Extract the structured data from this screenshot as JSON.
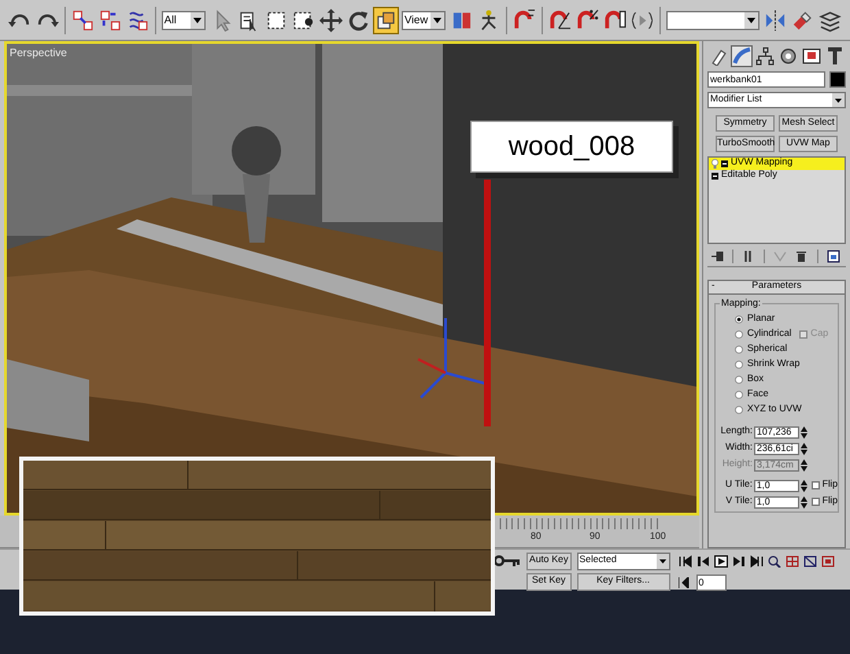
{
  "toolbar": {
    "items": [
      {
        "kind": "icon",
        "selected": false
      },
      {
        "kind": "icon",
        "selected": false
      },
      {
        "kind": "icon",
        "selected": false
      },
      {
        "kind": "icon",
        "selected": false
      },
      {
        "kind": "icon",
        "selected": false
      },
      {
        "kind": "dropdown",
        "value": "All"
      },
      {
        "kind": "icon",
        "selected": false
      },
      {
        "kind": "icon",
        "selected": false
      },
      {
        "kind": "icon",
        "selected": false
      },
      {
        "kind": "icon",
        "selected": false
      },
      {
        "kind": "icon",
        "selected": false
      },
      {
        "kind": "icon",
        "selected": false
      },
      {
        "kind": "icon",
        "selected": true
      },
      {
        "kind": "dropdown",
        "value": "View"
      },
      {
        "kind": "icon",
        "selected": false
      },
      {
        "kind": "icon",
        "selected": false
      },
      {
        "kind": "icon",
        "selected": false
      },
      {
        "kind": "icon",
        "selected": false
      },
      {
        "kind": "icon",
        "selected": false
      },
      {
        "kind": "icon",
        "selected": false
      },
      {
        "kind": "icon",
        "selected": false
      },
      {
        "kind": "dropdown",
        "value": ""
      },
      {
        "kind": "icon",
        "selected": false
      },
      {
        "kind": "icon",
        "selected": false
      },
      {
        "kind": "icon",
        "selected": false
      }
    ]
  },
  "viewport": {
    "label": "Perspective",
    "callout": "wood_008"
  },
  "command_panel": {
    "tabs": [
      {
        "selected": false
      },
      {
        "selected": true
      },
      {
        "selected": false
      },
      {
        "selected": false
      },
      {
        "selected": false
      },
      {
        "selected": false
      }
    ],
    "object_name": "werkbank01",
    "modifier_list": "Modifier List",
    "modifier_buttons": [
      "Symmetry",
      "Mesh Select",
      "TurboSmooth",
      "UVW Map"
    ],
    "stack": [
      {
        "label": "UVW Mapping",
        "selected": true
      },
      {
        "label": "Editable Poly",
        "selected": false
      }
    ],
    "parameters": {
      "collapse": "-",
      "title": "Parameters",
      "group": "Mapping:",
      "mapping": [
        {
          "label": "Planar",
          "selected": true
        },
        {
          "label": "Cylindrical",
          "selected": false,
          "option": {
            "label": "Cap",
            "checked": false
          }
        },
        {
          "label": "Spherical",
          "selected": false
        },
        {
          "label": "Shrink Wrap",
          "selected": false
        },
        {
          "label": "Box",
          "selected": false
        },
        {
          "label": "Face",
          "selected": false
        },
        {
          "label": "XYZ to UVW",
          "selected": false
        }
      ],
      "sizes": [
        {
          "label": "Length:",
          "value": "107,236",
          "disabled": false
        },
        {
          "label": "Width:",
          "value": "236,61ci",
          "disabled": false
        },
        {
          "label": "Height:",
          "value": "3,174cm",
          "disabled": true
        }
      ],
      "tiles": [
        {
          "label": "U Tile:",
          "value": "1,0",
          "flip": {
            "label": "Flip",
            "checked": false
          }
        },
        {
          "label": "V Tile:",
          "value": "1,0",
          "flip": {
            "label": "Flip",
            "checked": false
          }
        }
      ]
    }
  },
  "timeline": {
    "ticks": [
      "80",
      "90",
      "100"
    ]
  },
  "animation_controls": {
    "auto_key": "Auto Key",
    "set_key": "Set Key",
    "key_mode": "Selected",
    "key_filters": "Key Filters...",
    "frame": "0"
  }
}
